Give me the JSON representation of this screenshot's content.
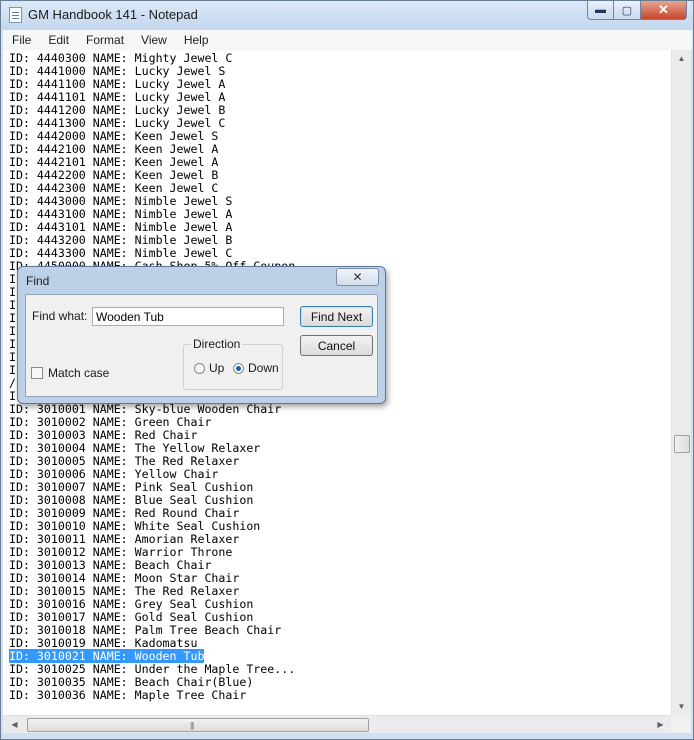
{
  "window": {
    "title": "GM Handbook 141 - Notepad"
  },
  "caption": {
    "min": "▬",
    "max": "▢",
    "close": "✕"
  },
  "menu": [
    "File",
    "Edit",
    "Format",
    "View",
    "Help"
  ],
  "lines": [
    "ID: 4440300 NAME: Mighty Jewel C",
    "ID: 4441000 NAME: Lucky Jewel S",
    "ID: 4441100 NAME: Lucky Jewel A",
    "ID: 4441101 NAME: Lucky Jewel A",
    "ID: 4441200 NAME: Lucky Jewel B",
    "ID: 4441300 NAME: Lucky Jewel C",
    "ID: 4442000 NAME: Keen Jewel S",
    "ID: 4442100 NAME: Keen Jewel A",
    "ID: 4442101 NAME: Keen Jewel A",
    "ID: 4442200 NAME: Keen Jewel B",
    "ID: 4442300 NAME: Keen Jewel C",
    "ID: 4443000 NAME: Nimble Jewel S",
    "ID: 4443100 NAME: Nimble Jewel A",
    "ID: 4443101 NAME: Nimble Jewel A",
    "ID: 4443200 NAME: Nimble Jewel B",
    "ID: 4443300 NAME: Nimble Jewel C",
    "ID: 4450000 NAME: Cash Shop 5% Off Coupon",
    "I",
    "I",
    "I",
    "I",
    "I",
    "I",
    "I",
    "I",
    "/",
    "I",
    "ID: 3010001 NAME: Sky-blue Wooden Chair",
    "ID: 3010002 NAME: Green Chair",
    "ID: 3010003 NAME: Red Chair",
    "ID: 3010004 NAME: The Yellow Relaxer",
    "ID: 3010005 NAME: The Red Relaxer",
    "ID: 3010006 NAME: Yellow Chair",
    "ID: 3010007 NAME: Pink Seal Cushion",
    "ID: 3010008 NAME: Blue Seal Cushion",
    "ID: 3010009 NAME: Red Round Chair",
    "ID: 3010010 NAME: White Seal Cushion",
    "ID: 3010011 NAME: Amorian Relaxer",
    "ID: 3010012 NAME: Warrior Throne",
    "ID: 3010013 NAME: Beach Chair",
    "ID: 3010014 NAME: Moon Star Chair",
    "ID: 3010015 NAME: The Red Relaxer",
    "ID: 3010016 NAME: Grey Seal Cushion",
    "ID: 3010017 NAME: Gold Seal Cushion",
    "ID: 3010018 NAME: Palm Tree Beach Chair",
    "ID: 3010019 NAME: Kadomatsu",
    "ID: 3010021 NAME: Wooden Tub",
    "ID: 3010025 NAME: Under the Maple Tree...",
    "ID: 3010035 NAME: Beach Chair(Blue)",
    "ID: 3010036 NAME: Maple Tree Chair"
  ],
  "selected_line_index": 46,
  "find_dialog": {
    "title": "Find",
    "close": "✕",
    "find_what_label": "Find what:",
    "find_what_value": "Wooden Tub",
    "find_next": "Find Next",
    "cancel": "Cancel",
    "direction_label": "Direction",
    "up_label": "Up",
    "down_label": "Down",
    "direction_selected": "Down",
    "match_case_label": "Match case",
    "match_case_checked": false
  },
  "scrollbar": {
    "up": "▲",
    "down": "▼",
    "left": "◀",
    "right": "▶",
    "grip": "|||"
  },
  "colors": {
    "selection": "#3399ff",
    "titlebar": "#c3d7ee",
    "close_button": "#c7452b"
  }
}
